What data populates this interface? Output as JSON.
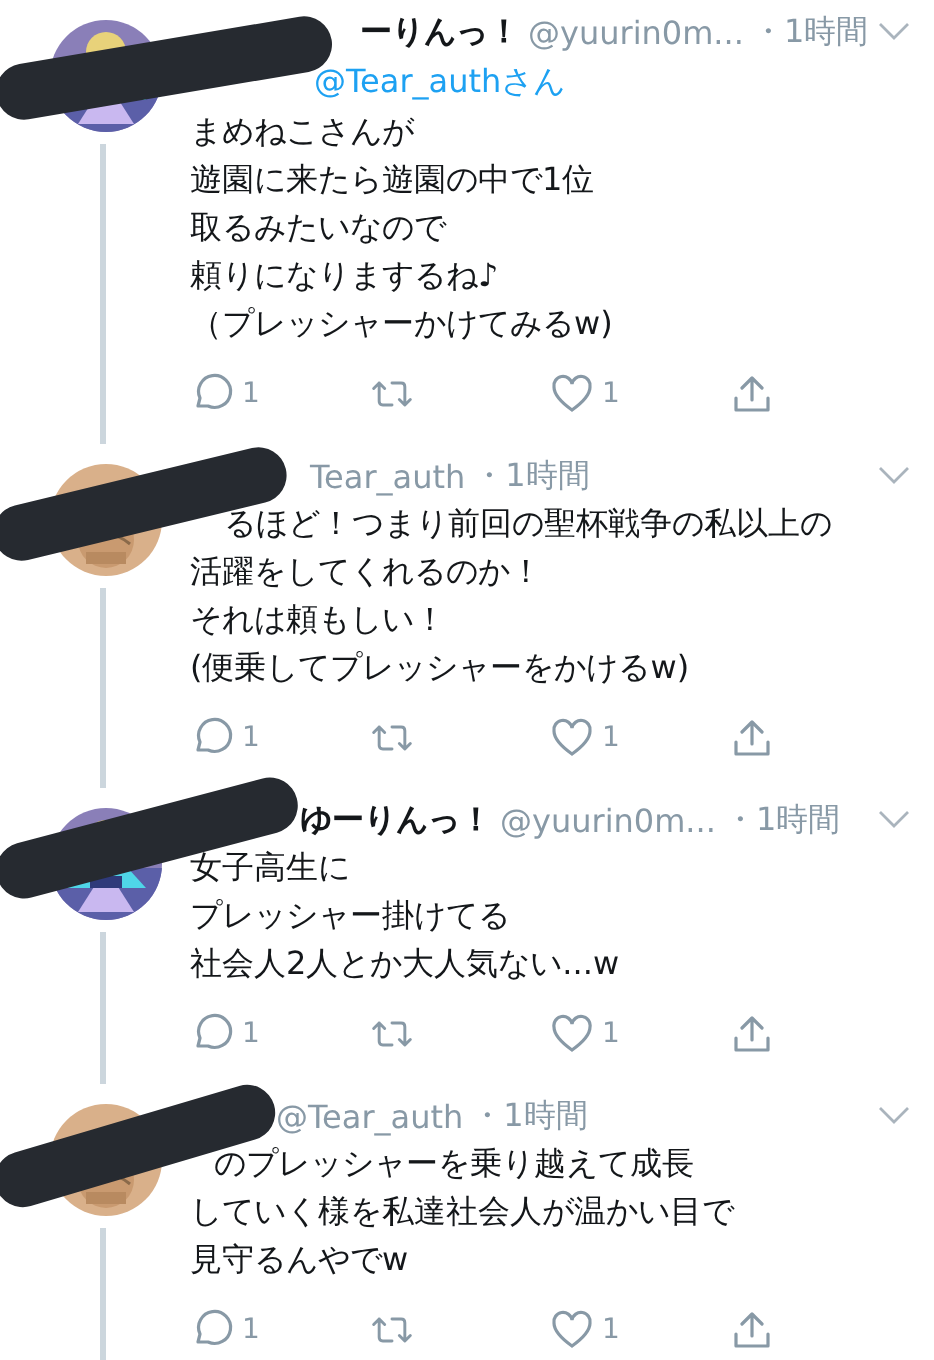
{
  "tweets": [
    {
      "name": "ーりんっ！",
      "handle": "@yuurin0m...",
      "time": "・1時間",
      "reply_to": "@Tear_authさん",
      "lines": [
        "まめねこさんが",
        "遊園に来たら遊園の中で1位",
        "取るみたいなので",
        "頼りになりまするね♪",
        "（プレッシャーかけてみるw)"
      ],
      "replies": "1",
      "likes": "1"
    },
    {
      "handle": "Tear_auth",
      "time": "・1時間",
      "lines": [
        "るほど！つまり前回の聖杯戦争の私以上の",
        "活躍をしてくれるのか！",
        "それは頼もしい！",
        "(便乗してプレッシャーをかけるw)"
      ],
      "replies": "1",
      "likes": "1"
    },
    {
      "name": "ゆーりんっ！",
      "handle": "@yuurin0m...",
      "time": "・1時間",
      "lines": [
        "女子高生に",
        "プレッシャー掛けてる",
        "社会人2人とか大人気ない...w"
      ],
      "replies": "1",
      "likes": "1"
    },
    {
      "handle": "@Tear_auth",
      "time": "・1時間",
      "lines": [
        "のプレッシャーを乗り越えて成長",
        "していく様を私達社会人が温かい目で",
        "見守るんやでw"
      ],
      "replies": "1",
      "likes": "1"
    }
  ]
}
